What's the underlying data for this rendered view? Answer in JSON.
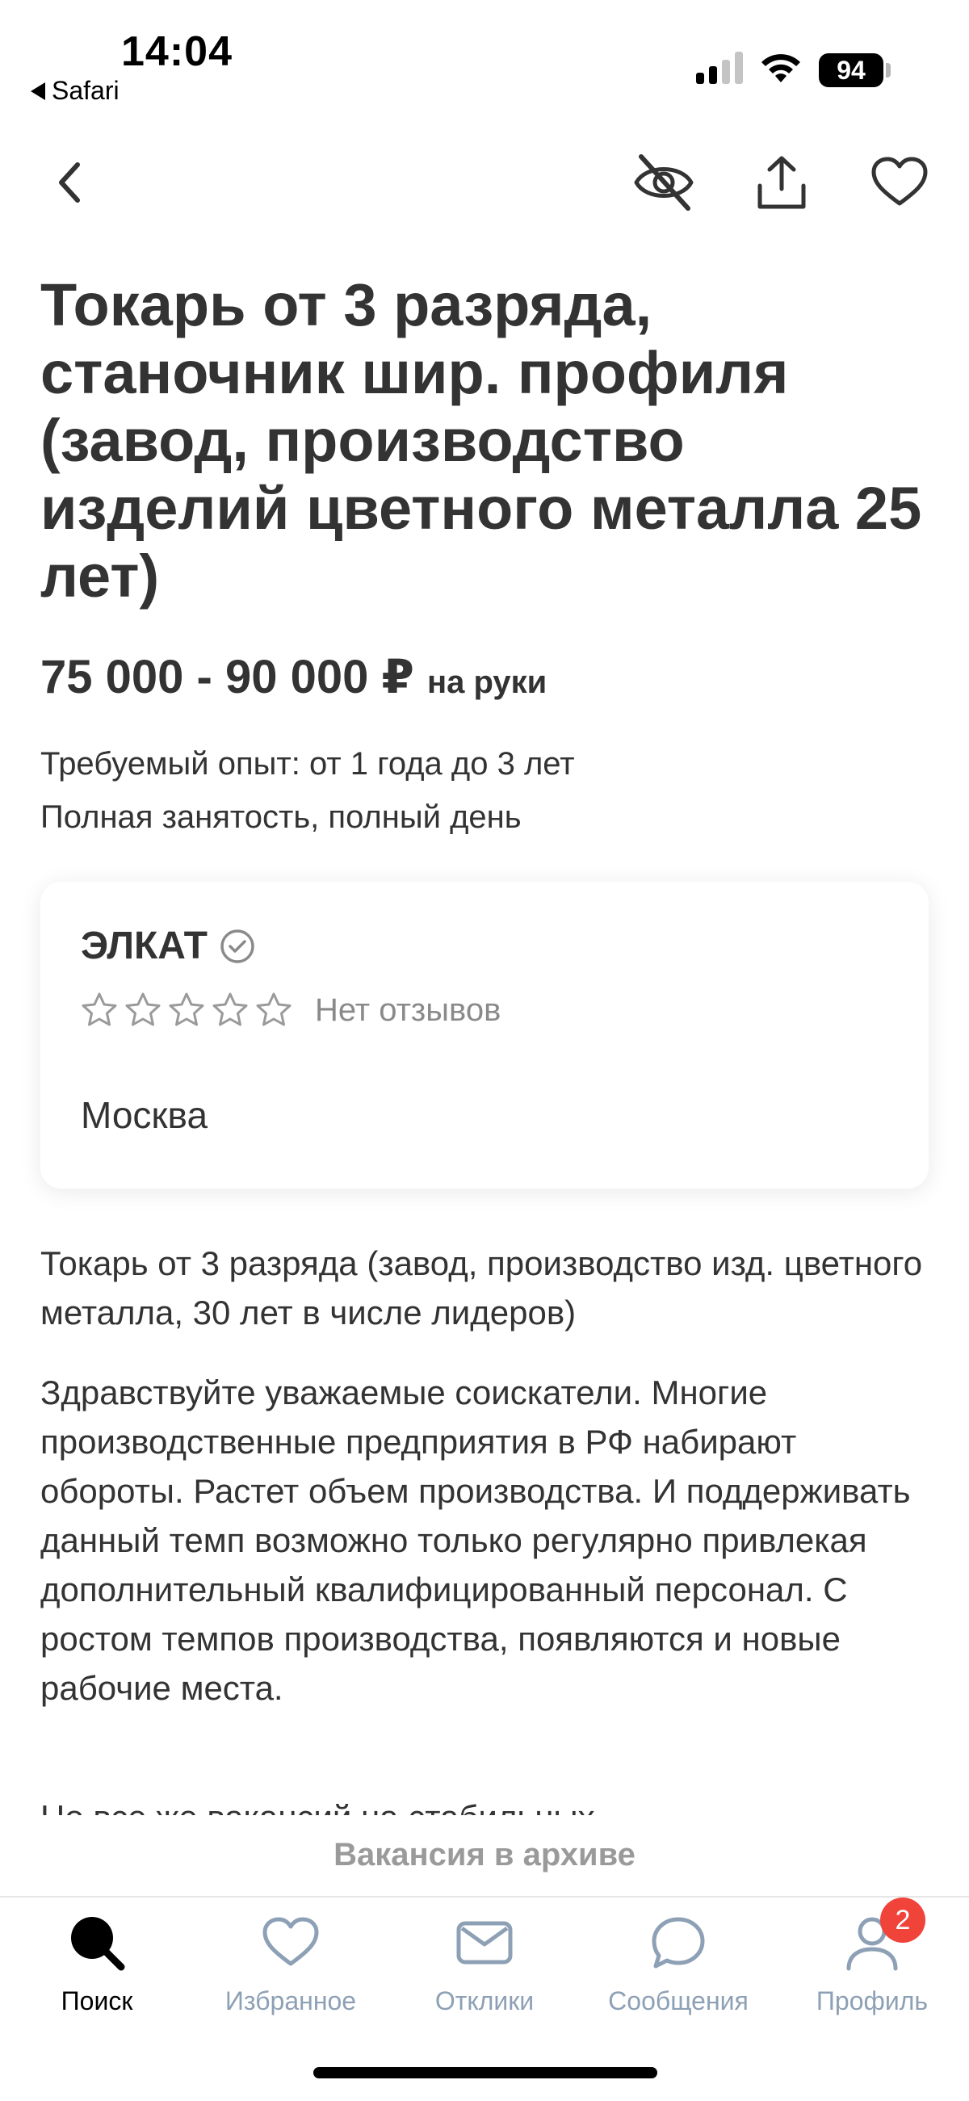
{
  "status_bar": {
    "time": "14:04",
    "back_app": "Safari",
    "battery": "94",
    "signal_icon": "cellular-signal-icon",
    "wifi_icon": "wifi-icon"
  },
  "nav": {
    "back_icon": "chevron-left-icon",
    "hide_icon": "eye-off-icon",
    "share_icon": "share-icon",
    "favorite_icon": "heart-icon"
  },
  "vacancy": {
    "title": "Токарь от 3 разряда, станочник шир. профиля (завод, производство изделий цветного металла 25 лет)",
    "salary": "75 000 - 90 000 ₽",
    "salary_suffix": "на руки",
    "experience": "Требуемый опыт: от 1 года до 3 лет",
    "employment": "Полная занятость, полный день"
  },
  "company": {
    "name": "ЭЛКАТ",
    "verified_icon": "verified-check-icon",
    "rating_stars": 0,
    "rating_max": 5,
    "reviews_text": "Нет отзывов",
    "city": "Москва"
  },
  "description": {
    "p1": "Токарь от 3 разряда (завод, производство изд. цветного металла, 30 лет в числе лидеров)",
    "p2": "Здравствуйте уважаемые соискатели. Многие производственные предприятия в РФ набирают обороты. Растет объем производства. И поддерживать данный темп возможно только регулярно привлекая дополнительный квалифицированный персонал. С ростом темпов производства, появляются и новые рабочие места.",
    "p3_partial": "Но все же вакансий на стабильных"
  },
  "archive_banner": "Вакансия в архиве",
  "tabs": [
    {
      "label": "Поиск",
      "icon": "search-icon",
      "active": true
    },
    {
      "label": "Избранное",
      "icon": "heart-icon",
      "active": false
    },
    {
      "label": "Отклики",
      "icon": "mail-icon",
      "active": false
    },
    {
      "label": "Сообщения",
      "icon": "chat-bubble-icon",
      "active": false
    },
    {
      "label": "Профиль",
      "icon": "person-icon",
      "active": false,
      "badge": "2"
    }
  ],
  "colors": {
    "text": "#333333",
    "muted": "#8a8a8a",
    "tab_inactive": "#8da0b5",
    "badge": "#f0433a"
  }
}
